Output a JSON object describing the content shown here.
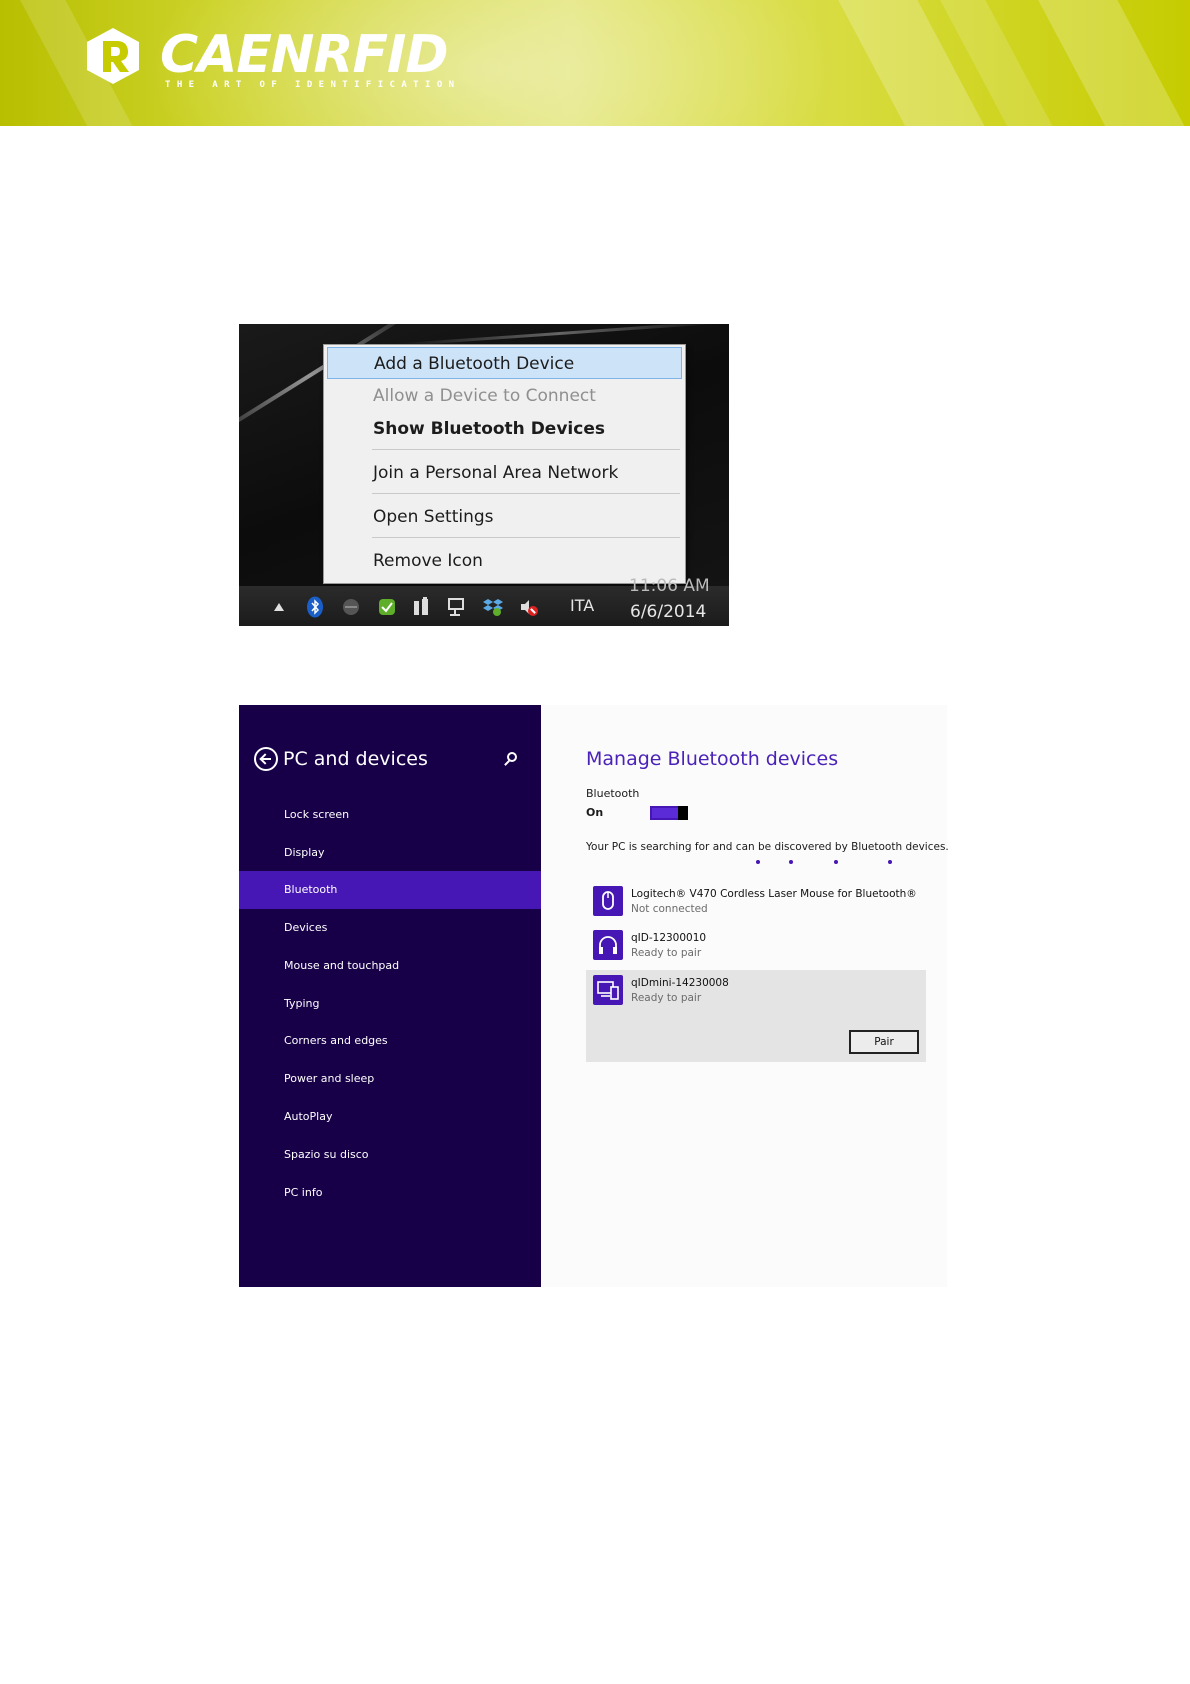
{
  "header": {
    "brand_name": "CAENRFID",
    "tagline": "THE ART OF IDENTIFICATION",
    "brand_color": "#c6cc00"
  },
  "context_menu": {
    "items": [
      {
        "label": "Add a Bluetooth Device",
        "state": "highlighted"
      },
      {
        "label": "Allow a Device to Connect",
        "state": "disabled"
      },
      {
        "label": "Show Bluetooth Devices",
        "state": "default-bold"
      },
      {
        "label": "Join a Personal Area Network",
        "state": "normal"
      },
      {
        "label": "Open Settings",
        "state": "normal"
      },
      {
        "label": "Remove Icon",
        "state": "normal"
      }
    ]
  },
  "taskbar": {
    "tray_icons": [
      "show-hidden-icons-arrow",
      "bluetooth-icon",
      "network-icon",
      "security-check-icon",
      "power-icon",
      "network-monitor-icon",
      "dropbox-icon",
      "volume-muted-icon"
    ],
    "language": "ITA",
    "time": "11:06 AM",
    "date": "6/6/2014"
  },
  "settings": {
    "title": "PC and devices",
    "nav": [
      {
        "label": "Lock screen",
        "active": false
      },
      {
        "label": "Display",
        "active": false
      },
      {
        "label": "Bluetooth",
        "active": true
      },
      {
        "label": "Devices",
        "active": false
      },
      {
        "label": "Mouse and touchpad",
        "active": false
      },
      {
        "label": "Typing",
        "active": false
      },
      {
        "label": "Corners and edges",
        "active": false
      },
      {
        "label": "Power and sleep",
        "active": false
      },
      {
        "label": "AutoPlay",
        "active": false
      },
      {
        "label": "Spazio su disco",
        "active": false
      },
      {
        "label": "PC info",
        "active": false
      }
    ],
    "main": {
      "title": "Manage Bluetooth devices",
      "bluetooth_label": "Bluetooth",
      "bluetooth_state": "On",
      "searching_message": "Your PC is searching for and can be discovered by Bluetooth devices.",
      "devices": [
        {
          "name": "Logitech® V470 Cordless Laser Mouse for Bluetooth®",
          "status": "Not connected",
          "icon": "mouse-icon"
        },
        {
          "name": "qID-12300010",
          "status": "Ready to pair",
          "icon": "headset-icon"
        },
        {
          "name": "qIDmini-14230008",
          "status": "Ready to pair",
          "icon": "devices-icon"
        }
      ],
      "pair_label": "Pair"
    },
    "accent_color": "#4617b4",
    "sidebar_color": "#170048"
  }
}
